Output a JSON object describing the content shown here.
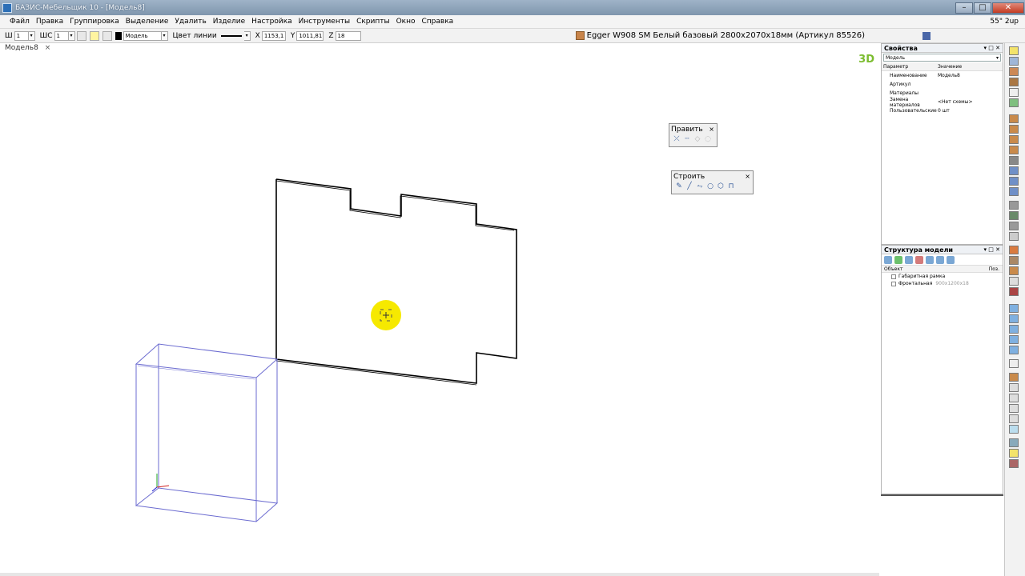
{
  "window": {
    "title": "БАЗИС-Мебельщик 10 - [Модель8]",
    "buttons": [
      "–",
      "□",
      "✕"
    ]
  },
  "menu": {
    "items": [
      "Файл",
      "Правка",
      "Группировка",
      "Выделение",
      "Удалить",
      "Изделие",
      "Настройка",
      "Инструменты",
      "Скрипты",
      "Окно",
      "Справка"
    ],
    "right_label": "55\" 2up"
  },
  "toolbar": {
    "w_label": "Ш",
    "w_value": "1",
    "ws_label": "ШС",
    "ws_value": "1",
    "layer_value": "Модель",
    "line_color_label": "Цвет линии",
    "x_label": "X",
    "x_value": "1153,1",
    "y_label": "Y",
    "y_value": "1011,81",
    "z_label": "Z",
    "z_value": "18",
    "material": "Egger W908 SM Белый базовый 2800х2070х18мм (Артикул 85526)"
  },
  "document": {
    "tab_label": "Модель8",
    "tab_close": "×",
    "view_label": "3D"
  },
  "float_edit": {
    "title": "Править",
    "close": "×"
  },
  "float_build": {
    "title": "Строить",
    "close": "×"
  },
  "properties": {
    "title": "Свойства",
    "header_controls": "▾ □ ✕",
    "object_type": "Модель",
    "col_param": "Параметр",
    "col_value": "Значение",
    "rows": [
      {
        "param": "Наименование",
        "value": "Модель8"
      },
      {
        "param": "Артикул",
        "value": ""
      },
      {
        "param": "Материалы",
        "value": ""
      },
      {
        "param": "Замена материалов",
        "value": "<Нет схемы>"
      },
      {
        "param": "Пользовательские",
        "value": "0 шт"
      }
    ]
  },
  "structure": {
    "title": "Структура модели",
    "header_controls": "▾ □ ✕",
    "col_object": "Объект",
    "col_pos": "Поз.",
    "nodes": [
      {
        "label": "Габаритная рамка",
        "dim": ""
      },
      {
        "label": "Фронтальная",
        "dim": "900х1200х18"
      }
    ]
  },
  "colors": {
    "panel_outline": "#000000",
    "frame_outline": "#5a5acb",
    "cursor_highlight": "#f6e900",
    "view_label": "#7bbc2e"
  }
}
